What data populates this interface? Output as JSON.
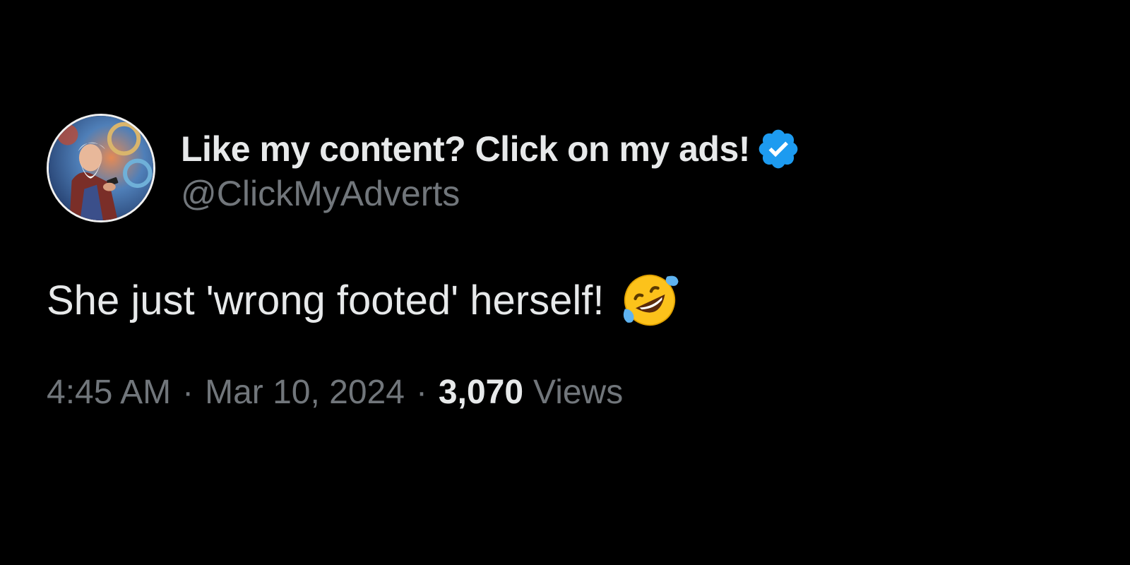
{
  "tweet": {
    "display_name": "Like my content? Click on my ads!",
    "handle": "@ClickMyAdverts",
    "verified_icon": "verified-badge-icon",
    "text": "She just 'wrong footed' herself!",
    "emoji": "rolling-on-floor-laughing-emoji",
    "time": "4:45 AM",
    "separator": "·",
    "date": "Mar 10, 2024",
    "views_count": "3,070",
    "views_label": "Views"
  },
  "colors": {
    "background": "#000000",
    "primary_text": "#e7e9ea",
    "secondary_text": "#71767b",
    "verified_blue": "#1d9bf0"
  }
}
